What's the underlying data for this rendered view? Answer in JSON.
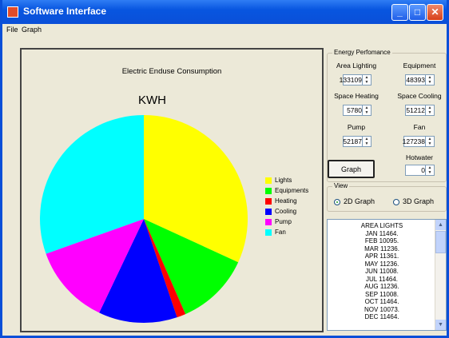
{
  "window": {
    "title": "Software Interface",
    "minimize": "_",
    "maximize": "□",
    "close": "✕"
  },
  "menu": [
    "File",
    "Graph"
  ],
  "chart_data": {
    "type": "pie",
    "title": "Electric Enduse Consumption",
    "unit_label": "KWH",
    "categories": [
      "Lights",
      "Equipments",
      "Heating",
      "Cooling",
      "Pump",
      "Fan"
    ],
    "values": [
      133109,
      48393,
      5780,
      51212,
      52187,
      127238
    ],
    "colors": [
      "#ffff00",
      "#00ff00",
      "#ff0000",
      "#0000ff",
      "#ff00ff",
      "#00ffff"
    ],
    "legend_position": "right"
  },
  "energy": {
    "title": "Energy Perfomance",
    "fields": [
      {
        "label": "Area Lighting",
        "value": "133109"
      },
      {
        "label": "Equipment",
        "value": "48393"
      },
      {
        "label": "Space Heating",
        "value": "5780"
      },
      {
        "label": "Space Cooling",
        "value": "51212"
      },
      {
        "label": "Pump",
        "value": "52187"
      },
      {
        "label": "Fan",
        "value": "127238"
      },
      {
        "label": "Hotwater",
        "value": "0"
      }
    ],
    "graph_button": "Graph"
  },
  "view": {
    "title": "View",
    "option_2d": "2D Graph",
    "option_3d": "3D Graph",
    "selected": "2D Graph"
  },
  "output": {
    "lines": [
      "AREA LIGHTS",
      "JAN 11464.",
      "FEB 10095.",
      "MAR 11236.",
      "APR 11361.",
      "MAY 11236.",
      "JUN 11008.",
      "JUL 11464.",
      "AUG 11236.",
      "SEP 11008.",
      "OCT 11464.",
      "NOV 10073.",
      "DEC 11464."
    ]
  }
}
